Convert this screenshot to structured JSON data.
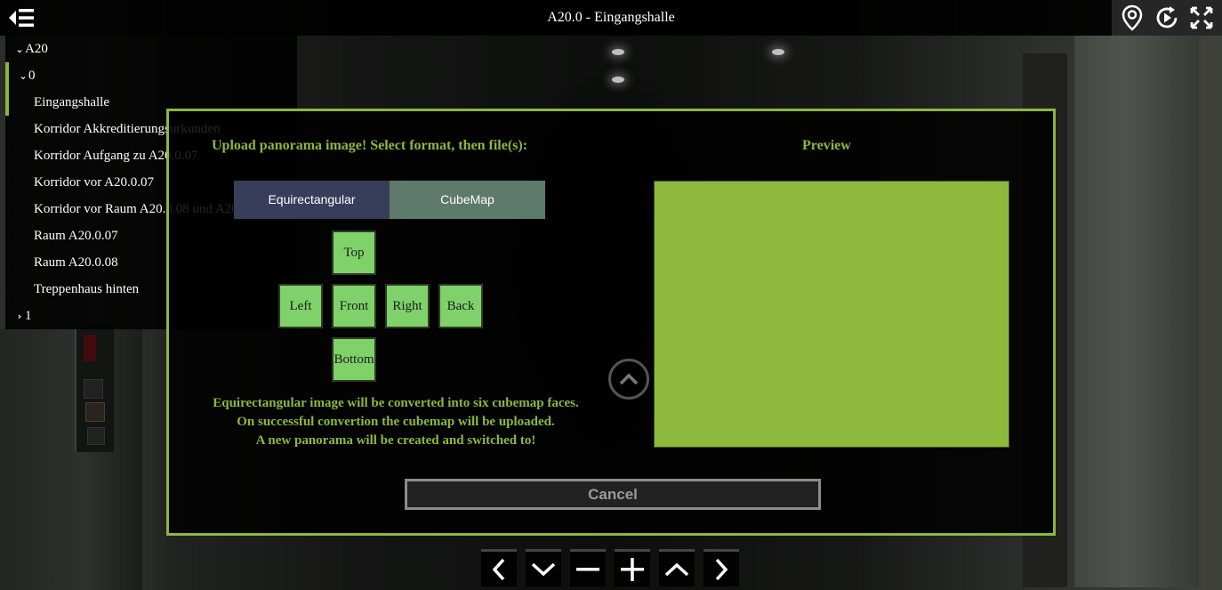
{
  "app": {
    "title": "A20.0 - Eingangshalle"
  },
  "topbar": {
    "menu_icon": "menu-collapse-icon",
    "icons": [
      "location-pin-icon",
      "autorotate-icon",
      "fullscreen-icon"
    ]
  },
  "tree": {
    "root": "A20",
    "floor0": "0",
    "items": [
      "Eingangshalle",
      "Korridor Akkreditierungsurkunden",
      "Korridor Aufgang zu A20.0.07",
      "Korridor vor A20.0.07",
      "Korridor vor Raum A20.0.08 und A20.0.09",
      "Raum A20.0.07",
      "Raum A20.0.08",
      "Treppenhaus hinten"
    ],
    "floor1": "1"
  },
  "modal": {
    "heading": "Upload panorama image! Select format, then file(s):",
    "preview_heading": "Preview",
    "format_equirect": "Equirectangular",
    "format_cubemap": "CubeMap",
    "faces": {
      "top": "Top",
      "left": "Left",
      "front": "Front",
      "right": "Right",
      "back": "Back",
      "bottom": "Bottom"
    },
    "info_line1": "Equirectangular image will be converted into six cubemap faces.",
    "info_line2": "On successful convertion the cubemap will be uploaded.",
    "info_line3": "A new panorama will be created and switched to!",
    "cancel": "Cancel"
  },
  "colors": {
    "accent": "#8cb83c",
    "face": "#7fd26a",
    "equirect_bg": "#383e5a",
    "cubemap_bg": "#5e7a6c"
  },
  "bottomnav": [
    "chevron-left-icon",
    "chevron-down-icon",
    "zoom-out-icon",
    "zoom-in-icon",
    "chevron-up-icon",
    "chevron-right-icon"
  ]
}
